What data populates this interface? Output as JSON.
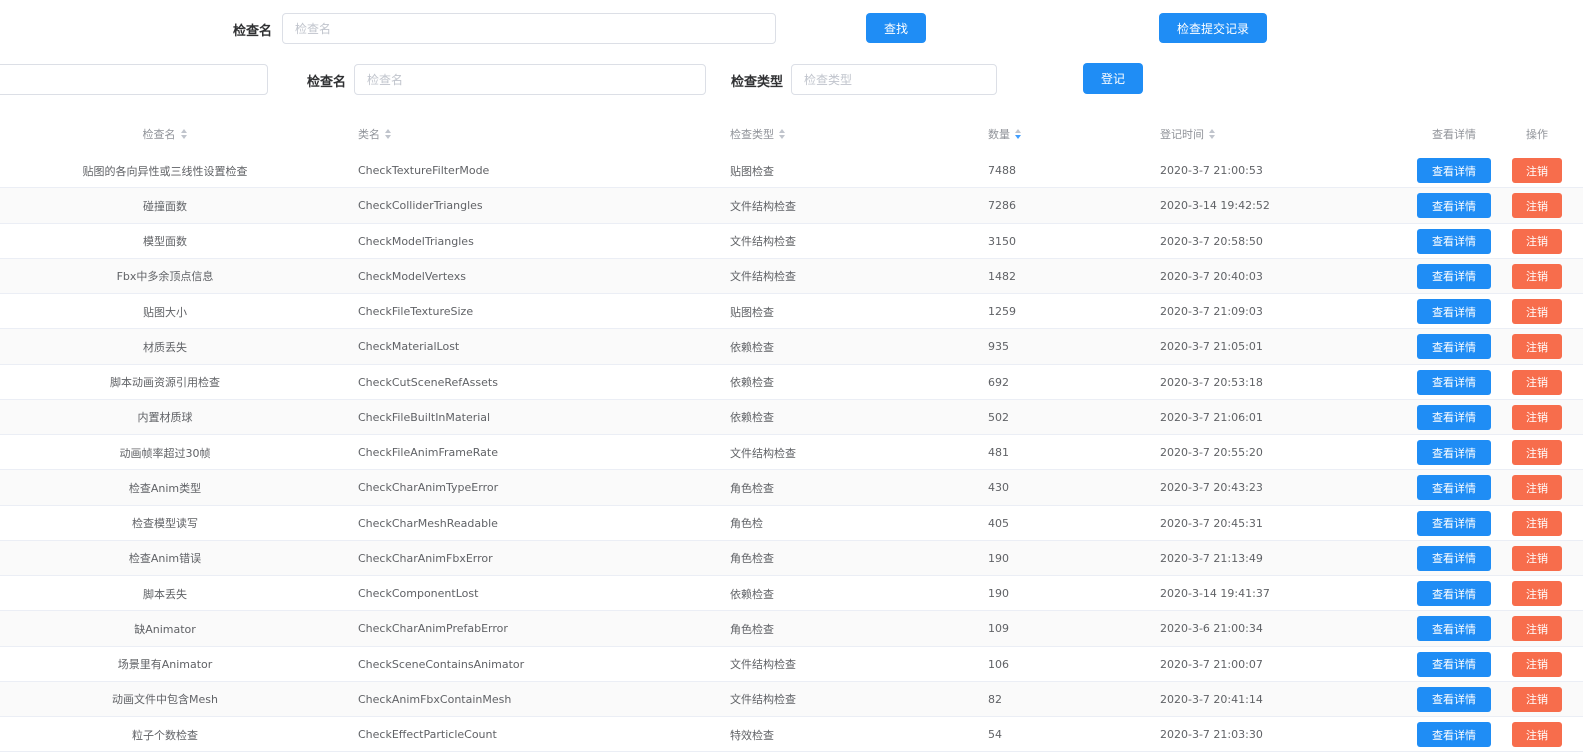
{
  "search": {
    "label": "检查名",
    "placeholder": "检查名",
    "button": "查找",
    "history_button": "检查提交记录"
  },
  "register": {
    "name_label": "检查名",
    "name_placeholder": "检查名",
    "type_label": "检查类型",
    "type_placeholder": "检查类型",
    "button": "登记"
  },
  "table": {
    "headers": {
      "name": "检查名",
      "class": "类名",
      "type": "检查类型",
      "count": "数量",
      "time": "登记时间",
      "detail": "查看详情",
      "op": "操作"
    },
    "sort_active_column": "count",
    "view_button": "查看详情",
    "cancel_button": "注销",
    "rows": [
      {
        "name": "贴图的各向异性或三线性设置检查",
        "class": "CheckTextureFilterMode",
        "type": "贴图检查",
        "count": "7488",
        "time": "2020-3-7 21:00:53"
      },
      {
        "name": "碰撞面数",
        "class": "CheckColliderTriangles",
        "type": "文件结构检查",
        "count": "7286",
        "time": "2020-3-14 19:42:52"
      },
      {
        "name": "模型面数",
        "class": "CheckModelTriangles",
        "type": "文件结构检查",
        "count": "3150",
        "time": "2020-3-7 20:58:50"
      },
      {
        "name": "Fbx中多余顶点信息",
        "class": "CheckModelVertexs",
        "type": "文件结构检查",
        "count": "1482",
        "time": "2020-3-7 20:40:03"
      },
      {
        "name": "贴图大小",
        "class": "CheckFileTextureSize",
        "type": "贴图检查",
        "count": "1259",
        "time": "2020-3-7 21:09:03"
      },
      {
        "name": "材质丢失",
        "class": "CheckMaterialLost",
        "type": "依赖检查",
        "count": "935",
        "time": "2020-3-7 21:05:01"
      },
      {
        "name": "脚本动画资源引用检查",
        "class": "CheckCutSceneRefAssets",
        "type": "依赖检查",
        "count": "692",
        "time": "2020-3-7 20:53:18"
      },
      {
        "name": "内置材质球",
        "class": "CheckFileBuiltInMaterial",
        "type": "依赖检查",
        "count": "502",
        "time": "2020-3-7 21:06:01"
      },
      {
        "name": "动画帧率超过30帧",
        "class": "CheckFileAnimFrameRate",
        "type": "文件结构检查",
        "count": "481",
        "time": "2020-3-7 20:55:20"
      },
      {
        "name": "检查Anim类型",
        "class": "CheckCharAnimTypeError",
        "type": "角色检查",
        "count": "430",
        "time": "2020-3-7 20:43:23"
      },
      {
        "name": "检查模型读写",
        "class": "CheckCharMeshReadable",
        "type": "角色检",
        "count": "405",
        "time": "2020-3-7 20:45:31"
      },
      {
        "name": "检查Anim错误",
        "class": "CheckCharAnimFbxError",
        "type": "角色检查",
        "count": "190",
        "time": "2020-3-7 21:13:49"
      },
      {
        "name": "脚本丢失",
        "class": "CheckComponentLost",
        "type": "依赖检查",
        "count": "190",
        "time": "2020-3-14 19:41:37"
      },
      {
        "name": "缺Animator",
        "class": "CheckCharAnimPrefabError",
        "type": "角色检查",
        "count": "109",
        "time": "2020-3-6 21:00:34"
      },
      {
        "name": "场景里有Animator",
        "class": "CheckSceneContainsAnimator",
        "type": "文件结构检查",
        "count": "106",
        "time": "2020-3-7 21:00:07"
      },
      {
        "name": "动画文件中包含Mesh",
        "class": "CheckAnimFbxContainMesh",
        "type": "文件结构检查",
        "count": "82",
        "time": "2020-3-7 20:41:14"
      },
      {
        "name": "粒子个数检查",
        "class": "CheckEffectParticleCount",
        "type": "特效检查",
        "count": "54",
        "time": "2020-3-7 21:03:30"
      }
    ]
  },
  "colors": {
    "primary": "#1f8df5",
    "danger": "#f76d4c",
    "header_text": "#909399",
    "cell_text": "#606266",
    "stripe": "#fafafa"
  }
}
